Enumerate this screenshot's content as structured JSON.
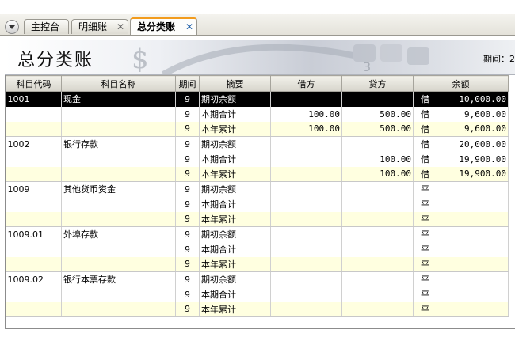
{
  "tabs": [
    {
      "label": "主控台",
      "active": false,
      "closable": false
    },
    {
      "label": "明细账",
      "active": false,
      "closable": true
    },
    {
      "label": "总分类账",
      "active": true,
      "closable": true
    }
  ],
  "tab_close_symbol": "✕",
  "header": {
    "title": "总分类账",
    "period_text": "期间：2"
  },
  "columns": [
    "科目代码",
    "科目名称",
    "期间",
    "摘要",
    "借方",
    "贷方",
    "余额"
  ],
  "rows": [
    {
      "code": "1001",
      "name": "现金",
      "period": "9",
      "summary": "期初余额",
      "debit": "",
      "credit": "",
      "dir": "借",
      "balance": "10,000.00"
    },
    {
      "code": "",
      "name": "",
      "period": "9",
      "summary": "本期合计",
      "debit": "100.00",
      "credit": "500.00",
      "dir": "借",
      "balance": "9,600.00"
    },
    {
      "code": "",
      "name": "",
      "period": "9",
      "summary": "本年累计",
      "debit": "100.00",
      "credit": "500.00",
      "dir": "借",
      "balance": "9,600.00"
    },
    {
      "code": "1002",
      "name": "银行存款",
      "period": "9",
      "summary": "期初余额",
      "debit": "",
      "credit": "",
      "dir": "借",
      "balance": "20,000.00"
    },
    {
      "code": "",
      "name": "",
      "period": "9",
      "summary": "本期合计",
      "debit": "",
      "credit": "100.00",
      "dir": "借",
      "balance": "19,900.00"
    },
    {
      "code": "",
      "name": "",
      "period": "9",
      "summary": "本年累计",
      "debit": "",
      "credit": "100.00",
      "dir": "借",
      "balance": "19,900.00"
    },
    {
      "code": "1009",
      "name": "其他货币资金",
      "period": "9",
      "summary": "期初余额",
      "debit": "",
      "credit": "",
      "dir": "平",
      "balance": ""
    },
    {
      "code": "",
      "name": "",
      "period": "9",
      "summary": "本期合计",
      "debit": "",
      "credit": "",
      "dir": "平",
      "balance": ""
    },
    {
      "code": "",
      "name": "",
      "period": "9",
      "summary": "本年累计",
      "debit": "",
      "credit": "",
      "dir": "平",
      "balance": ""
    },
    {
      "code": "1009.01",
      "name": "外埠存款",
      "period": "9",
      "summary": "期初余额",
      "debit": "",
      "credit": "",
      "dir": "平",
      "balance": ""
    },
    {
      "code": "",
      "name": "",
      "period": "9",
      "summary": "本期合计",
      "debit": "",
      "credit": "",
      "dir": "平",
      "balance": ""
    },
    {
      "code": "",
      "name": "",
      "period": "9",
      "summary": "本年累计",
      "debit": "",
      "credit": "",
      "dir": "平",
      "balance": ""
    },
    {
      "code": "1009.02",
      "name": "银行本票存款",
      "period": "9",
      "summary": "期初余额",
      "debit": "",
      "credit": "",
      "dir": "平",
      "balance": ""
    },
    {
      "code": "",
      "name": "",
      "period": "9",
      "summary": "本期合计",
      "debit": "",
      "credit": "",
      "dir": "平",
      "balance": ""
    },
    {
      "code": "",
      "name": "",
      "period": "9",
      "summary": "本年累计",
      "debit": "",
      "credit": "",
      "dir": "平",
      "balance": ""
    }
  ],
  "selected_row": 0,
  "colors": {
    "selected_bg": "#000000",
    "alt_row_bg": "#ffffe0",
    "active_tab_accent": "#f29b1d"
  }
}
